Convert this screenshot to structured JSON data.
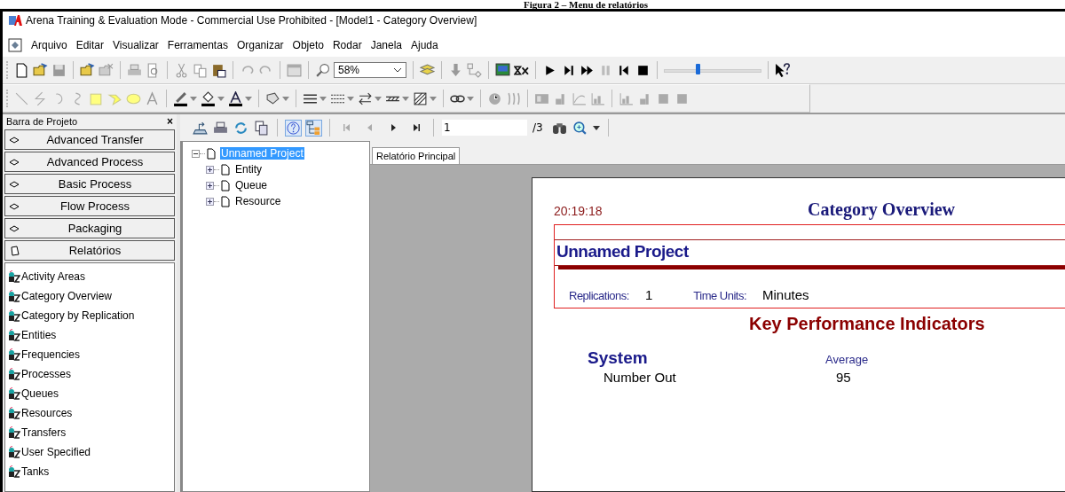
{
  "caption": "Figura 2 – Menu de relatórios",
  "window": {
    "title": "Arena Training & Evaluation Mode - Commercial Use Prohibited - [Model1 - Category Overview]"
  },
  "menu": [
    "Arquivo",
    "Editar",
    "Visualizar",
    "Ferramentas",
    "Organizar",
    "Objeto",
    "Rodar",
    "Janela",
    "Ajuda"
  ],
  "toolbar": {
    "zoom": "58%",
    "speed_slider": {
      "level": 0.33
    }
  },
  "project_bar": {
    "title": "Barra de Projeto",
    "close": "×"
  },
  "panels": [
    {
      "label": "Advanced Transfer",
      "kind": "template"
    },
    {
      "label": "Advanced Process",
      "kind": "template"
    },
    {
      "label": "Basic Process",
      "kind": "template"
    },
    {
      "label": "Flow Process",
      "kind": "template"
    },
    {
      "label": "Packaging",
      "kind": "template"
    },
    {
      "label": "Relatórios",
      "kind": "reports"
    }
  ],
  "reports": [
    "Activity Areas",
    "Category Overview",
    "Category by Replication",
    "Entities",
    "Frequencies",
    "Processes",
    "Queues",
    "Resources",
    "Transfers",
    "User Specified",
    "Tanks"
  ],
  "report_toolbar": {
    "page": "1",
    "page_count": "/3"
  },
  "tree": {
    "label": "Unnamed Project",
    "selected": true,
    "expanded": true,
    "children": [
      {
        "label": "Entity",
        "selected": false,
        "expanded": false
      },
      {
        "label": "Queue",
        "selected": false,
        "expanded": false
      },
      {
        "label": "Resource",
        "selected": false,
        "expanded": false
      }
    ]
  },
  "tabs": [
    {
      "label": "Relatório Principal",
      "selected": true
    }
  ],
  "report": {
    "time": "20:19:18",
    "title": "Category Overview",
    "project": "Unnamed Project",
    "replications_label": "Replications:",
    "replications": "1",
    "time_units_label": "Time Units:",
    "time_units": "Minutes",
    "section": "Key Performance Indicators",
    "group": "System",
    "column": "Average",
    "rows": [
      {
        "label": "Number Out",
        "value": "95"
      }
    ]
  }
}
